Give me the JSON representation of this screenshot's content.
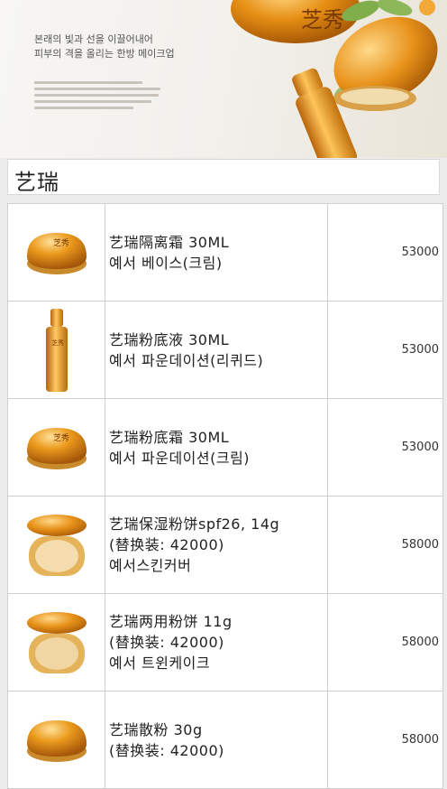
{
  "banner": {
    "tagline_1": "본래의 빛과 선을 이끌어내어",
    "tagline_2": "피부의 격을 올리는 한방 메이크업",
    "brand_mark": "芝秀"
  },
  "section_title": "艺瑞",
  "products": [
    {
      "icon": "cream-jar-icon",
      "lines": [
        "艺瑞隔离霜 30ML",
        "예서 베이스(크림)"
      ],
      "price": "53000"
    },
    {
      "icon": "liquid-bottle-icon",
      "lines": [
        "艺瑞粉底液 30ML",
        "예서 파운데이션(리퀴드)"
      ],
      "price": "53000"
    },
    {
      "icon": "cream-jar-icon",
      "lines": [
        "艺瑞粉底霜 30ML",
        "예서 파운데이션(크림)"
      ],
      "price": "53000"
    },
    {
      "icon": "cushion-compact-icon",
      "lines": [
        "艺瑞保湿粉饼spf26, 14g",
        "(替换装: 42000)",
        "예서스킨커버"
      ],
      "price": "58000"
    },
    {
      "icon": "cushion-compact-icon",
      "lines": [
        "艺瑞两用粉饼 11g",
        "(替换装: 42000)",
        "예서 트윈케이크"
      ],
      "price": "58000"
    },
    {
      "icon": "cream-jar-icon",
      "lines": [
        "艺瑞散粉 30g",
        "(替换装: 42000)"
      ],
      "price": "58000"
    }
  ],
  "colors": {
    "gold": "#e39a1c",
    "gold_dark": "#a55a06",
    "border": "#cfcfcf"
  }
}
